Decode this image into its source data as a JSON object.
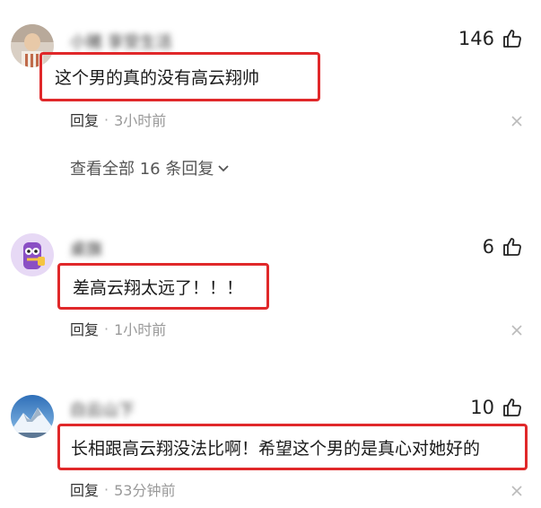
{
  "comments": [
    {
      "author": "小猪 享受生活",
      "likes": "146",
      "text": "这个男的真的没有高云翔帅",
      "reply_label": "回复",
      "separator": "·",
      "time": "3小时前",
      "expand_label": "查看全部 16 条回复"
    },
    {
      "author": "桌旗",
      "likes": "6",
      "text": "差高云翔太远了！！！",
      "reply_label": "回复",
      "separator": "·",
      "time": "1小时前"
    },
    {
      "author": "白云山下",
      "likes": "10",
      "text": "长相跟高云翔没法比啊！希望这个男的是真心对她好的",
      "reply_label": "回复",
      "separator": "·",
      "time": "53分钟前"
    }
  ],
  "colors": {
    "highlight_border": "#e0282a",
    "meta_text": "#999999",
    "icon_gray": "#bbbbbb"
  },
  "icons": {
    "like": "thumbs-up-icon",
    "close": "close-icon",
    "expand": "chevron-down-icon"
  }
}
